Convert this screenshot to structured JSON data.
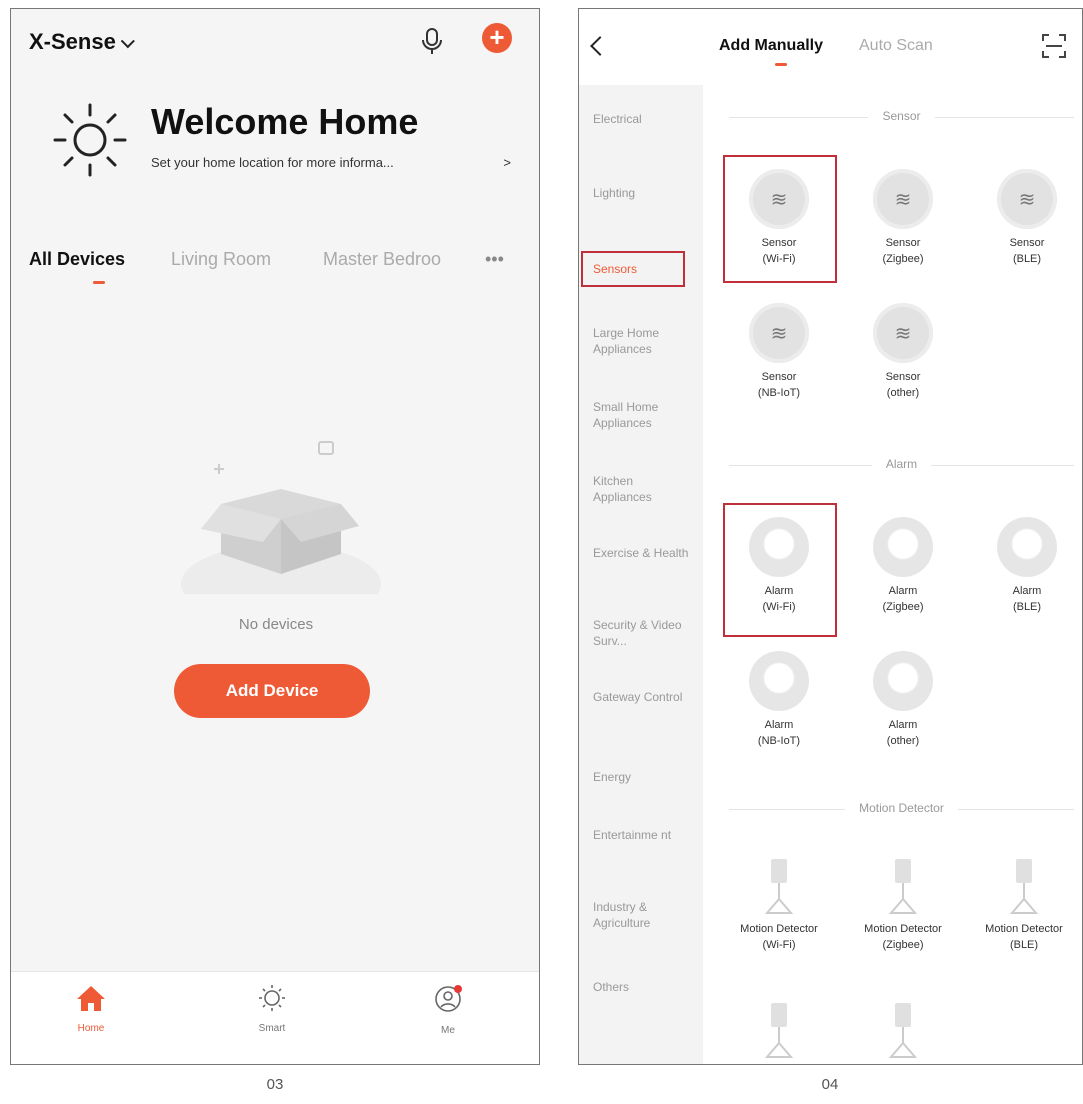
{
  "screen1": {
    "home_selector": "X-Sense",
    "welcome_title": "Welcome Home",
    "location_prompt": "Set your home location for more informa...",
    "location_arrow": ">",
    "tabs": [
      "All Devices",
      "Living Room",
      "Master Bedroo"
    ],
    "more_tabs": "•••",
    "empty_text": "No devices",
    "add_device_label": "Add Device",
    "tabbar": [
      {
        "label": "Home",
        "icon": "home-icon"
      },
      {
        "label": "Smart",
        "icon": "sun-icon"
      },
      {
        "label": "Me",
        "icon": "profile-icon"
      }
    ],
    "caption": "03"
  },
  "screen2": {
    "tabs": [
      "Add Manually",
      "Auto Scan"
    ],
    "categories": [
      "Electrical",
      "Lighting",
      "Sensors",
      "Large Home Appliances",
      "Small Home Appliances",
      "Kitchen Appliances",
      "Exercise & Health",
      "Security & Video Surv...",
      "Gateway Control",
      "Energy",
      "Entertainme nt",
      "Industry & Agriculture",
      "Others"
    ],
    "selected_category": "Sensors",
    "sections": [
      {
        "title": "Sensor",
        "devices": [
          {
            "line1": "Sensor",
            "line2": "(Wi-Fi)"
          },
          {
            "line1": "Sensor",
            "line2": "(Zigbee)"
          },
          {
            "line1": "Sensor",
            "line2": "(BLE)"
          },
          {
            "line1": "Sensor",
            "line2": "(NB-IoT)"
          },
          {
            "line1": "Sensor",
            "line2": "(other)"
          }
        ]
      },
      {
        "title": "Alarm",
        "devices": [
          {
            "line1": "Alarm",
            "line2": "(Wi-Fi)"
          },
          {
            "line1": "Alarm",
            "line2": "(Zigbee)"
          },
          {
            "line1": "Alarm",
            "line2": "(BLE)"
          },
          {
            "line1": "Alarm",
            "line2": "(NB-IoT)"
          },
          {
            "line1": "Alarm",
            "line2": "(other)"
          }
        ]
      },
      {
        "title": "Motion Detector",
        "devices": [
          {
            "line1": "Motion Detector",
            "line2": "(Wi-Fi)"
          },
          {
            "line1": "Motion Detector",
            "line2": "(Zigbee)"
          },
          {
            "line1": "Motion Detector",
            "line2": "(BLE)"
          }
        ]
      }
    ],
    "caption": "04"
  },
  "colors": {
    "accent": "#ee5a35",
    "highlight_box": "#c0303b"
  }
}
